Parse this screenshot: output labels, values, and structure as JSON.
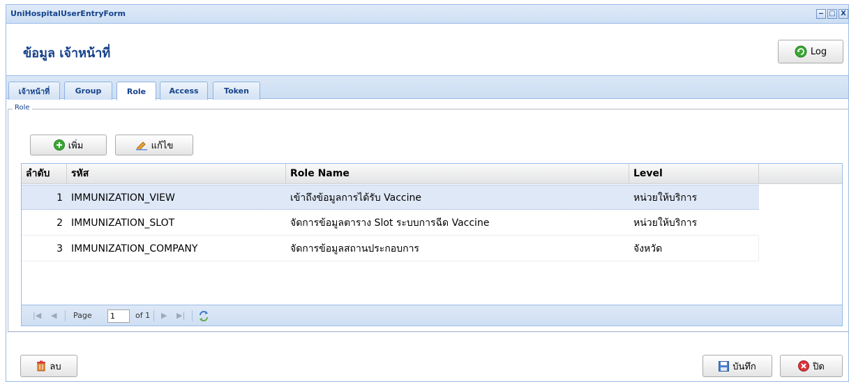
{
  "window": {
    "title": "UniHospitalUserEntryForm",
    "controls": [
      "‒",
      "□",
      "X"
    ]
  },
  "header": {
    "title": "ข้อมูล เจ้าหน้าที่",
    "log_label": "Log"
  },
  "tabs": [
    {
      "label": "เจ้าหน้าที่",
      "active": false
    },
    {
      "label": "Group",
      "active": false
    },
    {
      "label": "Role",
      "active": true
    },
    {
      "label": "Access",
      "active": false
    },
    {
      "label": "Token",
      "active": false
    }
  ],
  "role_section": {
    "legend": "Role",
    "add_label": "เพิ่ม",
    "edit_label": "แก้ไข"
  },
  "grid": {
    "columns": [
      "ลำดับ",
      "รหัส",
      "Role Name",
      "Level"
    ],
    "rows": [
      {
        "no": "1",
        "code": "IMMUNIZATION_VIEW",
        "name": "เข้าถึงข้อมูลการได้รับ Vaccine",
        "level": "หน่วยให้บริการ",
        "selected": true
      },
      {
        "no": "2",
        "code": "IMMUNIZATION_SLOT",
        "name": "จัดการข้อมูลตาราง Slot ระบบการฉีด Vaccine",
        "level": "หน่วยให้บริการ",
        "selected": false
      },
      {
        "no": "3",
        "code": "IMMUNIZATION_COMPANY",
        "name": "จัดการข้อมูลสถานประกอบการ",
        "level": "จังหวัด",
        "selected": false
      }
    ]
  },
  "pager": {
    "page_label": "Page",
    "page_value": "1",
    "of_label": "of 1"
  },
  "footer": {
    "delete_label": "ลบ",
    "save_label": "บันทึก",
    "close_label": "ปิด"
  },
  "colors": {
    "title_blue": "#15428b",
    "border_blue": "#99bbe8",
    "selected_row": "#dfe8f6",
    "add_green": "#3aa835",
    "close_red": "#d9363e"
  }
}
